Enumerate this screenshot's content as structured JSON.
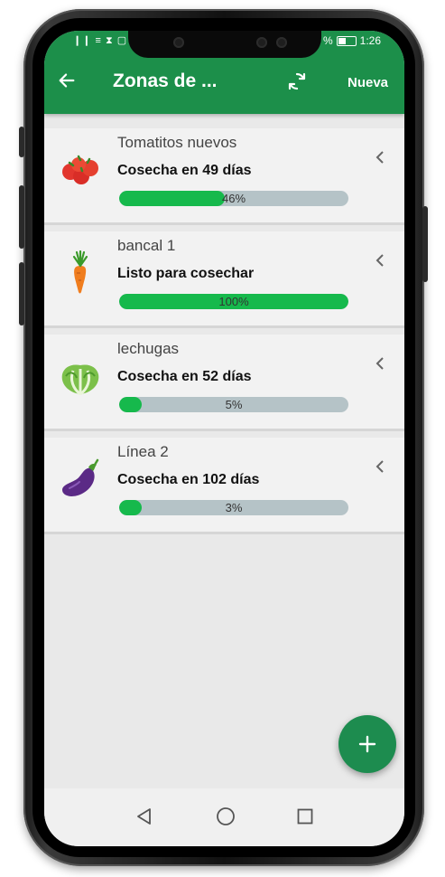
{
  "status": {
    "left_icons": "❙❙ ≡ ⧗ ▢",
    "battery_pct": "%",
    "time": "1:26"
  },
  "appbar": {
    "title": "Zonas de ...",
    "new_label": "Nueva",
    "back_icon": "arrow-left-icon",
    "sync_icon": "sync-icon"
  },
  "colors": {
    "primary": "#1c8f4a",
    "progress": "#16b94c",
    "track": "#b5c3c7",
    "fab": "#1d8c4f"
  },
  "zones": [
    {
      "name": "Tomatitos nuevos",
      "harvest": "Cosecha en 49 días",
      "progress": 0.46,
      "progress_label": "46%",
      "icon": "tomato-icon"
    },
    {
      "name": "bancal 1",
      "harvest": "Listo para cosechar",
      "progress": 1.0,
      "progress_label": "100%",
      "icon": "carrot-icon"
    },
    {
      "name": "lechugas",
      "harvest": "Cosecha en 52 días",
      "progress": 0.05,
      "progress_label": "5%",
      "icon": "lettuce-icon"
    },
    {
      "name": "Línea 2",
      "harvest": "Cosecha en 102 días",
      "progress": 0.03,
      "progress_label": "3%",
      "icon": "eggplant-icon"
    }
  ],
  "fab": {
    "icon": "plus-icon"
  },
  "navbar": {
    "back_icon": "nav-back-icon",
    "home_icon": "nav-home-icon",
    "recents_icon": "nav-recents-icon"
  }
}
